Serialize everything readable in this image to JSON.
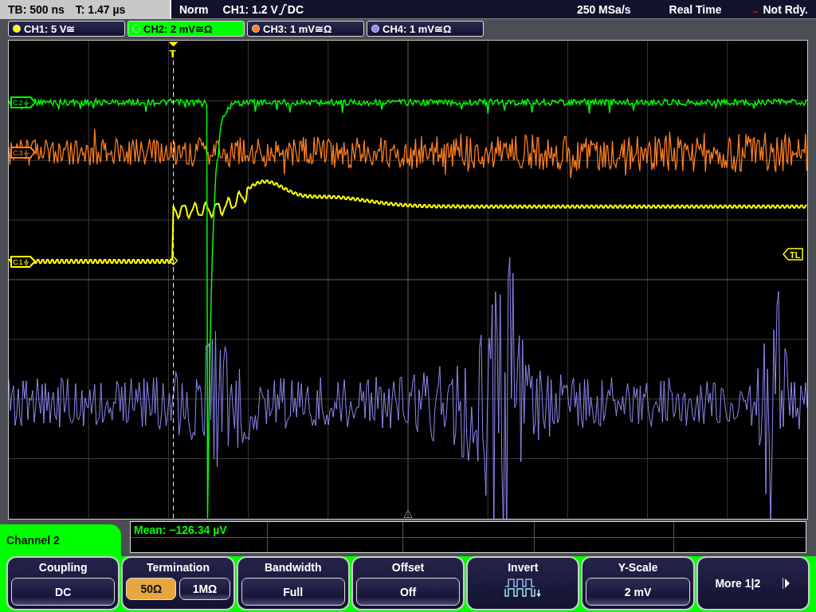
{
  "status_bar": {
    "timebase": "TB: 500 ns",
    "trigger_time": "T: 1.47 µs",
    "mode": "Norm",
    "trigger_source": "CH1: 1.2 V",
    "trigger_coupling": "DC",
    "sample_rate": "250 MSa/s",
    "acquisition": "Real Time",
    "state": "Not Rdy."
  },
  "channels": [
    {
      "label": "CH1: 5 V≅",
      "color": "#ffff00",
      "selected": false
    },
    {
      "label": "CH2: 2 mV≅Ω",
      "color": "#00ff00",
      "selected": true
    },
    {
      "label": "CH3: 1 mV≅Ω",
      "color": "#ff7f1e",
      "selected": false
    },
    {
      "label": "CH4: 1 mV≅Ω",
      "color": "#8f8cf5",
      "selected": false
    }
  ],
  "channel_markers": [
    {
      "label": "C2",
      "color": "#00ff00"
    },
    {
      "label": "C3",
      "color": "#ff7f1e"
    },
    {
      "label": "C1",
      "color": "#ffff00"
    }
  ],
  "trigger_marker": "T",
  "trigger_level_marker": "TL",
  "measurement": "Mean: −126.34 µV",
  "menu": {
    "title": "Channel 2",
    "softkeys": [
      {
        "kind": "value",
        "label": "Coupling",
        "value": "DC"
      },
      {
        "kind": "toggle",
        "label": "Termination",
        "options": [
          {
            "label": "50Ω",
            "selected": true
          },
          {
            "label": "1MΩ",
            "selected": false
          }
        ]
      },
      {
        "kind": "value",
        "label": "Bandwidth",
        "value": "Full"
      },
      {
        "kind": "value",
        "label": "Offset",
        "value": "Off"
      },
      {
        "kind": "icon",
        "label": "Invert"
      },
      {
        "kind": "value",
        "label": "Y-Scale",
        "value": "2 mV"
      },
      {
        "kind": "next",
        "label": "More 1|2"
      }
    ]
  }
}
